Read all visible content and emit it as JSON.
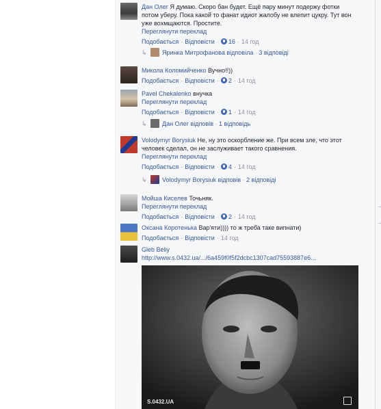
{
  "ui": {
    "like_label": "Подобається",
    "reply_label": "Відповісти",
    "translate_label": "Переглянути переклад"
  },
  "comments": [
    {
      "author": "Дан Олег",
      "text": "Я думаю. Скоро бан будет. Ещё пару минут подержу фотки потом уберу. Пока какой то фанат идиот жалобу не влепит цукру. Тут вон уже вохмщаются. Простите.",
      "likes": "16",
      "time": "14 год",
      "replies": {
        "name": "Яринка Митрофанова",
        "verb": "відповіла",
        "count": "3 відповіді"
      }
    },
    {
      "author": "Микола Коломийченко",
      "text": "Вучно!!))",
      "likes": "2",
      "time": "14 год"
    },
    {
      "author": "Pavel Chekalenko",
      "text": "внучка",
      "likes": "1",
      "time": "14 год",
      "replies": {
        "name": "Дан Олег",
        "verb": "відповів",
        "count": "1 відповідь"
      }
    },
    {
      "author": "Volodymyr Borysiuk",
      "text": "Не, ну это оскорбление же. При всем зле, что этот человек сделал, он не заслуживает такого сравнения.",
      "likes": "4",
      "time": "14 год",
      "replies": {
        "name": "Volodymyr Borysiuk",
        "verb": "відповів",
        "count": "2 відповіді"
      }
    },
    {
      "author": "Мойша Киселев",
      "text": "Точьняк.",
      "likes": "2",
      "time": "14 год"
    },
    {
      "author": "Оксана Коротенька",
      "text": "Вар'яти)))) то ж треба таке випнати)",
      "time": "14 год"
    },
    {
      "author": "Gleb Beliy",
      "link": "http://www.s.0432.ua/.../6a459f0f5f2dcbc1307cad7559​3887e6...",
      "watermark": "S.0432.UA"
    }
  ],
  "colors": {
    "link": "#365899",
    "muted": "#90949c",
    "like_blue": "#4267b2",
    "feed_bg": "#f6f7f9"
  }
}
